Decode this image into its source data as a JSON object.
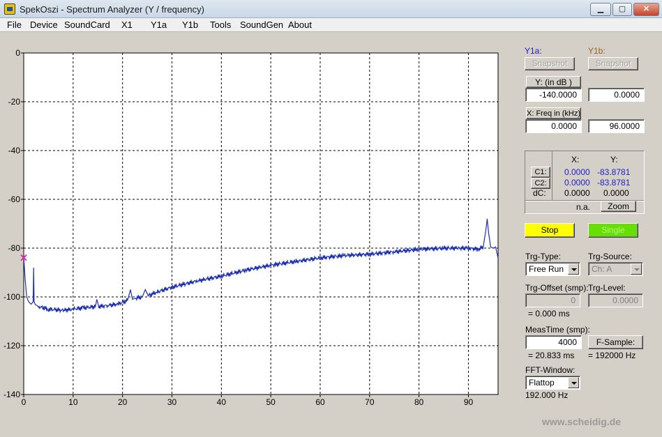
{
  "window": {
    "title": "SpekOszi - Spectrum Analyzer (Y / frequency)",
    "minimize_icon": "minimize-icon",
    "maximize_icon": "maximize-icon",
    "close_icon": "close-icon"
  },
  "menu": [
    "File",
    "Device",
    "SoundCard",
    "X1",
    "Y1a",
    "Y1b",
    "Tools",
    "SoundGen",
    "About"
  ],
  "panel": {
    "y1a_label": "Y1a:",
    "y1b_label": "Y1b:",
    "snapshot_label": "Snapshot",
    "y_button": "Y: (in dB )",
    "y_min": "-140.0000",
    "y_max": "0.0000",
    "x_button": "X: Freq in (kHz)",
    "x_min": "0.0000",
    "x_max": "96.0000",
    "cursor_x_header": "X:",
    "cursor_y_header": "Y:",
    "c1_button": "C1:",
    "c2_button": "C2:",
    "dc_label": "dC:",
    "c1_x": "0.0000",
    "c1_y": "-83.8781",
    "c2_x": "0.0000",
    "c2_y": "-83.8781",
    "dc_x": "0.0000",
    "dc_y": "0.0000",
    "na_label": "n.a.",
    "zoom_button": "Zoom",
    "stop_button": "Stop",
    "single_button": "Single",
    "trg_type_label": "Trg-Type:",
    "trg_type_value": "Free Run",
    "trg_source_label": "Trg-Source:",
    "trg_source_value": "Ch: A",
    "trg_offset_label": "Trg-Offset (smp):",
    "trg_offset_value": "0",
    "trg_offset_ms": "= 0.000 ms",
    "trg_level_label": "Trg-Level:",
    "trg_level_value": "0.0000",
    "meastime_label": "MeasTime (smp):",
    "meastime_value": "4000",
    "meastime_ms": "= 20.833 ms",
    "fsample_button": "F-Sample:",
    "fsample_value": "= 192000 Hz",
    "fft_window_label": "FFT-Window:",
    "fft_window_value": "Flattop",
    "fft_rate": "192.000 Hz",
    "watermark": "www.scheidig.de"
  },
  "colors": {
    "trace": "#1a2fb0",
    "cursor_marker": "#e0309a",
    "stop_bg": "#ffff00",
    "single_bg": "#66e000",
    "y1a_label": "#2020c8",
    "y1b_label": "#a06020"
  },
  "chart_data": {
    "type": "line",
    "xlim": [
      0,
      96
    ],
    "ylim": [
      -140,
      0
    ],
    "x_ticks": [
      0,
      10,
      20,
      30,
      40,
      50,
      60,
      70,
      80,
      90
    ],
    "y_ticks": [
      0,
      -20,
      -40,
      -60,
      -80,
      -100,
      -120,
      -140
    ],
    "grid": true,
    "series": [
      {
        "x": [
          0,
          0.3,
          0.6,
          1.0,
          1.5,
          1.9,
          2.0,
          2.1,
          2.3,
          3,
          5,
          8,
          10,
          12,
          14.5,
          14.8,
          15.2,
          17,
          19,
          21,
          21.6,
          22,
          22.6,
          24,
          24.6,
          25.2,
          27,
          30,
          35,
          40,
          45,
          50,
          55,
          60,
          65,
          70,
          75,
          80,
          85,
          88,
          90,
          92,
          93,
          93.5,
          93.8,
          94.1,
          94.5,
          95,
          95.5,
          96
        ],
        "y": [
          -83.9,
          -93,
          -100,
          -102,
          -103,
          -102,
          -88,
          -102,
          -103,
          -104,
          -105,
          -105.5,
          -105,
          -104.5,
          -104,
          -101,
          -104,
          -103.5,
          -103,
          -101.5,
          -97,
          -101,
          -100.5,
          -100,
          -97,
          -99.5,
          -98,
          -96,
          -93.5,
          -91.5,
          -89,
          -87,
          -85.5,
          -84,
          -83,
          -82.5,
          -81.5,
          -80.5,
          -80,
          -80,
          -80,
          -80.5,
          -79.5,
          -73,
          -68,
          -74,
          -79.5,
          -80,
          -79.5,
          -84
        ]
      }
    ],
    "marker": {
      "x": 0,
      "y": -83.9
    }
  }
}
